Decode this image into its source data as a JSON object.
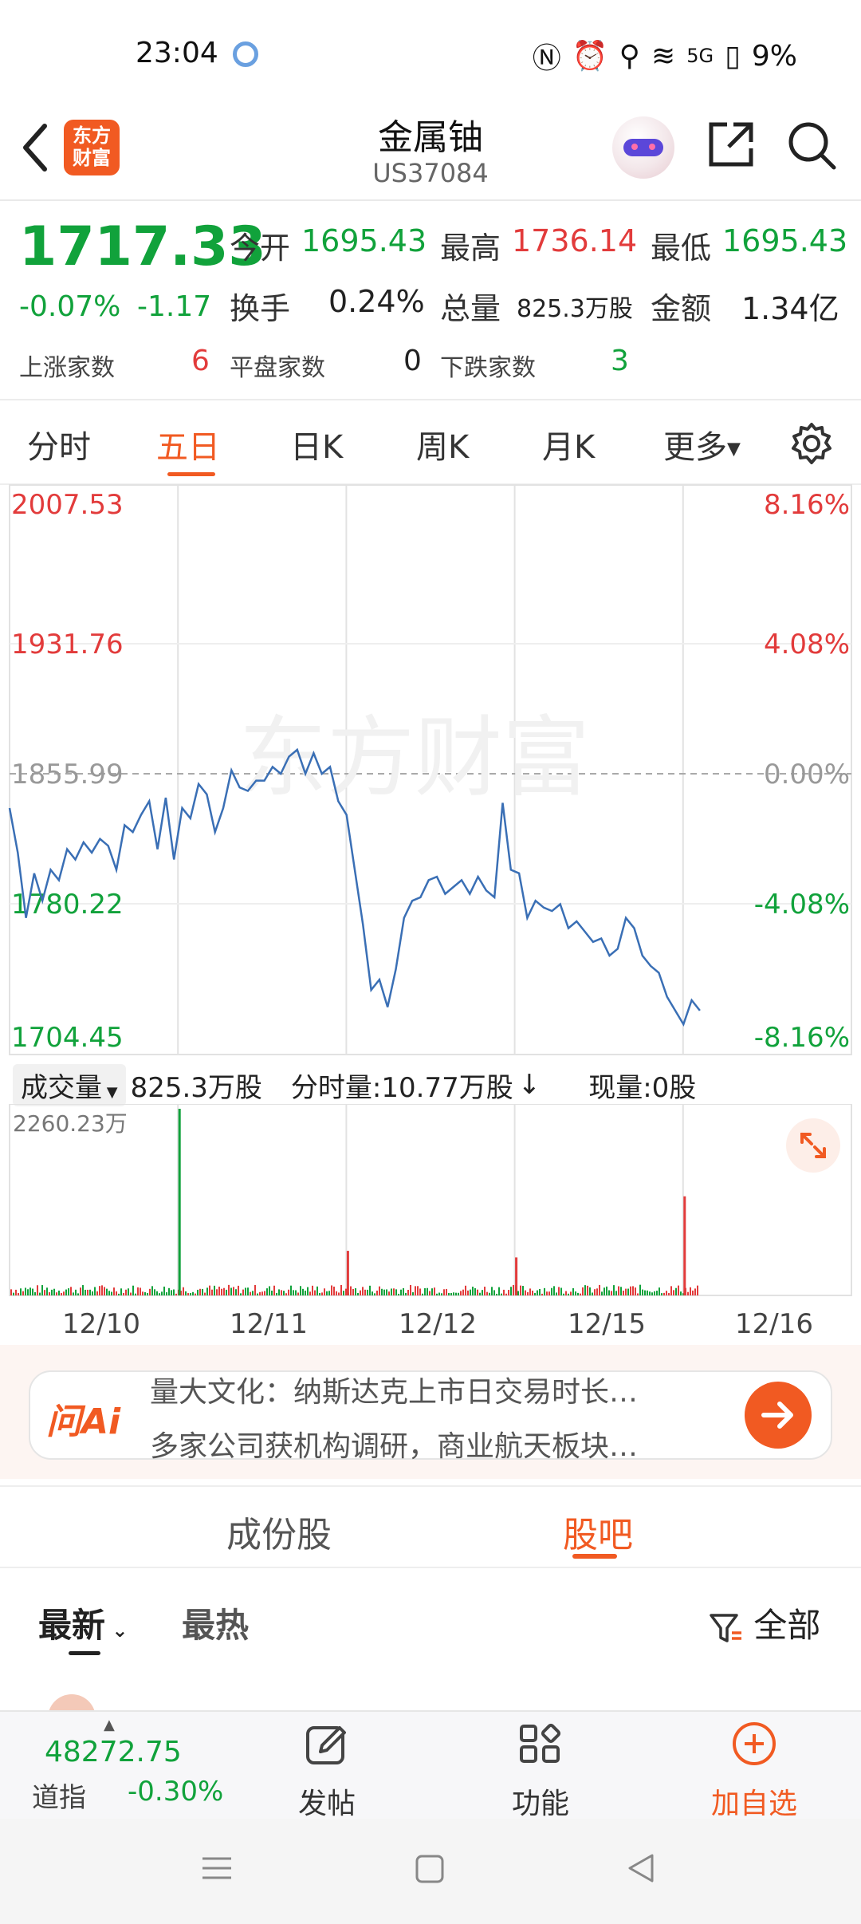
{
  "status_bar": {
    "time": "23:04",
    "battery": "9%",
    "network": "5G"
  },
  "header": {
    "title": "金属铀",
    "code": "US37084",
    "logo_text_line1": "东方",
    "logo_text_line2": "财富"
  },
  "quote": {
    "price": "1717.33",
    "change_pct": "-0.07%",
    "change": "-1.17",
    "open_label": "今开",
    "open": "1695.43",
    "high_label": "最高",
    "high": "1736.14",
    "low_label": "最低",
    "low": "1695.43",
    "turnover_label": "换手",
    "turnover": "0.24%",
    "volume_label": "总量",
    "volume": "825.3万股",
    "amount_label": "金额",
    "amount": "1.34亿",
    "up_label": "上涨家数",
    "up": "6",
    "flat_label": "平盘家数",
    "flat": "0",
    "down_label": "下跌家数",
    "down": "3"
  },
  "tabs": [
    "分时",
    "五日",
    "日K",
    "周K",
    "月K",
    "更多"
  ],
  "active_tab": "五日",
  "chart_data": {
    "type": "line",
    "y_left_labels": [
      "2007.53",
      "1931.76",
      "1855.99",
      "1780.22",
      "1704.45"
    ],
    "y_right_labels": [
      "8.16%",
      "4.08%",
      "0.00%",
      "-4.08%",
      "-8.16%"
    ],
    "ylim": [
      1704.45,
      2007.53
    ],
    "reference": 1855.99,
    "x_labels": [
      "12/10",
      "12/11",
      "12/12",
      "12/15",
      "12/16"
    ],
    "price_series": [
      1836,
      1810,
      1772,
      1798,
      1782,
      1800,
      1794,
      1812,
      1806,
      1816,
      1810,
      1818,
      1814,
      1800,
      1826,
      1822,
      1832,
      1840,
      1812,
      1842,
      1806,
      1836,
      1830,
      1850,
      1844,
      1822,
      1836,
      1858,
      1848,
      1846,
      1852,
      1852,
      1860,
      1856,
      1866,
      1870,
      1856,
      1868,
      1856,
      1860,
      1840,
      1832,
      1800,
      1768,
      1730,
      1736,
      1720,
      1742,
      1772,
      1782,
      1784,
      1794,
      1796,
      1786,
      1790,
      1794,
      1786,
      1796,
      1788,
      1784,
      1839,
      1800,
      1798,
      1772,
      1782,
      1778,
      1776,
      1780,
      1766,
      1770,
      1764,
      1758,
      1760,
      1750,
      1754,
      1772,
      1766,
      1750,
      1744,
      1740,
      1726,
      1718,
      1710,
      1724,
      1718
    ],
    "volume_max_label": "2260.23万",
    "volume_spikes": [
      {
        "day": 1,
        "value": 2260,
        "color": "green"
      },
      {
        "day": 2,
        "value": 540,
        "color": "red"
      },
      {
        "day": 3,
        "value": 460,
        "color": "red"
      },
      {
        "day": 4,
        "value": 1200,
        "color": "red"
      }
    ]
  },
  "volume_bar": {
    "select_label": "成交量",
    "total": "825.3万股",
    "period_label": "分时量:10.77万股",
    "arrow": "↓",
    "current": "现量:0股"
  },
  "ai": {
    "logo": "问Ai",
    "line1": "量大文化：纳斯达克上市日交易时长…",
    "line2": "多家公司获机构调研，商业航天板块…"
  },
  "subtabs": [
    "成份股",
    "股吧"
  ],
  "active_subtab": "股吧",
  "filters": {
    "latest": "最新",
    "hot": "最热",
    "all": "全部"
  },
  "bottom_bar": {
    "index_value": "48272.75",
    "index_name": "道指",
    "index_change": "-0.30%",
    "post": "发帖",
    "functions": "功能",
    "add": "加自选"
  },
  "colors": {
    "brand": "#f15a22",
    "up": "#e23b3b",
    "down": "#11a23b",
    "line": "#3a6fb5"
  }
}
